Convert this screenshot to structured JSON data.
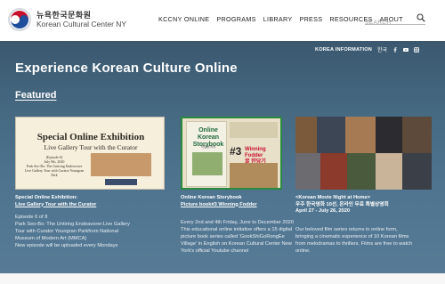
{
  "brand": {
    "name_korean": "뉴욕한국문화원",
    "name_english": "Korean Cultural Center NY"
  },
  "nav": [
    "KCCNY ONLINE",
    "PROGRAMS",
    "LIBRARY",
    "PRESS",
    "RESOURCES",
    "ABOUT"
  ],
  "search": {
    "placeholder": "SEARCH"
  },
  "utility": {
    "korea_information": "KOREA INFORMATION",
    "language": "한국",
    "social_icons": [
      "facebook-icon",
      "youtube-icon",
      "instagram-icon"
    ]
  },
  "page_title": "Experience Korean Culture Online",
  "section_title": "Featured",
  "cards": [
    {
      "image": {
        "heading": "Special Online Exhibition",
        "subheading": "Live Gallery Tour with the Curator",
        "episode": "[Episode 6]",
        "date": "July 9th, 2020",
        "detail_1": "Park Seo-Bo: The Untiring Endeavorer",
        "detail_2": "Live Gallery Tour with Curator Youngran Park"
      },
      "title_line1": "Special Online Exhibition:",
      "title_line2": "Live Gallery Tour with the Curator",
      "desc": [
        "Episode 6 of 8",
        "Park Seo-Bo: The Untiring Endeavorer:Live Gallery",
        "Tour with Curator Youngran Parkfrom National",
        "Museum of Modern Art (MMCA)",
        "New episode will be uploaded every Mondays"
      ]
    },
    {
      "image": {
        "title": "Online Korean Storybook",
        "korean": "국립한국어",
        "number": "#3",
        "winner": "Winning Fodder",
        "korean_winner": "꿀 한당기"
      },
      "title_line1": "Online Korean Storybook",
      "title_line2": "Picture book#3 Winning Fodder",
      "desc": [
        "Every 2nd and 4th Friday, June to December 2020",
        "This educational online initiative offers a 15 digital",
        "picture book series called 'GookShiGoRongEe",
        "Village' in English on Korean Cultural Center New",
        "York's official Youtube channel"
      ]
    },
    {
      "title_line1": "<Korean Movie Night at Home>",
      "title_line2": "우주 한국영화 10선, 온라인 무료 특별상영회",
      "title_line3": "April 27 - July 26, 2020",
      "desc": [
        "Our beloved film series returns in online form,",
        "bringing a cinematic experience of 10 Korean films",
        "from melodramas to thrillers. Films are free to watch",
        "online."
      ]
    }
  ],
  "colors": {
    "hero_bg": "#456a82",
    "storybook_border": "#2a8a3e",
    "header_bg": "#ffffff"
  }
}
